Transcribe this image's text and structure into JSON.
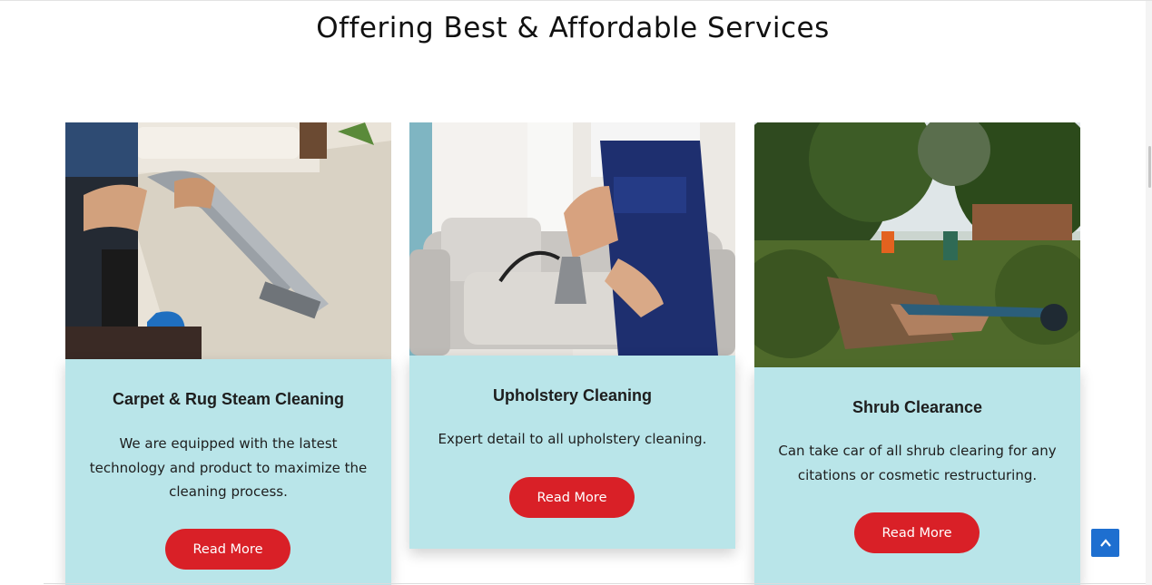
{
  "section": {
    "title": "Offering Best & Affordable Services"
  },
  "cards": [
    {
      "title": "Carpet & Rug Steam Cleaning",
      "description": "We are equipped with the latest technology and product to maximize the cleaning process.",
      "button_label": "Read More",
      "image": "carpet-steam-cleaning-photo"
    },
    {
      "title": "Upholstery Cleaning",
      "description": "Expert detail to all upholstery cleaning.",
      "button_label": "Read More",
      "image": "upholstery-cleaning-photo"
    },
    {
      "title": "Shrub Clearance",
      "description": "Can take car of all shrub clearing for any citations or cosmetic restructuring.",
      "button_label": "Read More",
      "image": "shrub-clearance-photo"
    }
  ],
  "scroll_top": {
    "icon": "chevron-up-icon"
  },
  "colors": {
    "card_bg": "#b9e5e9",
    "button": "#d92027",
    "scroll_top": "#1e6fd0"
  }
}
